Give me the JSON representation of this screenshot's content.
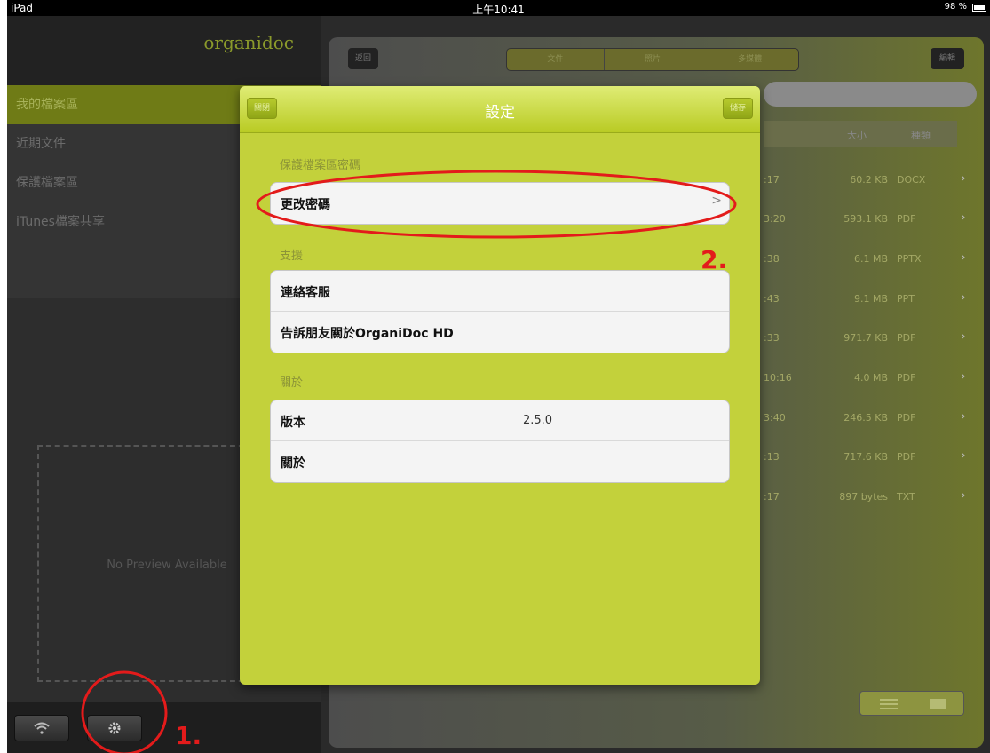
{
  "status_bar": {
    "device": "iPad",
    "time": "上午10:41",
    "battery": "98 %"
  },
  "sidebar": {
    "logo": "organidoc",
    "menu": [
      {
        "label": "我的檔案區",
        "active": true
      },
      {
        "label": "近期文件",
        "active": false
      },
      {
        "label": "保護檔案區",
        "active": false
      },
      {
        "label": "iTunes檔案共享",
        "active": false
      }
    ],
    "preview_text": "No Preview Available",
    "toolbar": {
      "wifi_icon": "wifi-icon",
      "settings_icon": "gear-icon"
    }
  },
  "content": {
    "back_label": "返回",
    "segments": [
      "文件",
      "照片",
      "多媒體"
    ],
    "edit_label": "編輯",
    "columns": {
      "size": "大小",
      "type": "種類"
    },
    "rows": [
      {
        "time": ":17",
        "size": "60.2 KB",
        "type": "DOCX"
      },
      {
        "time": "3:20",
        "size": "593.1 KB",
        "type": "PDF"
      },
      {
        "time": ":38",
        "size": "6.1 MB",
        "type": "PPTX"
      },
      {
        "time": ":43",
        "size": "9.1 MB",
        "type": "PPT"
      },
      {
        "time": ":33",
        "size": "971.7 KB",
        "type": "PDF"
      },
      {
        "time": "10:16",
        "size": "4.0 MB",
        "type": "PDF"
      },
      {
        "time": "3:40",
        "size": "246.5 KB",
        "type": "PDF"
      },
      {
        "time": ":13",
        "size": "717.6 KB",
        "type": "PDF"
      },
      {
        "time": ":17",
        "size": "897 bytes",
        "type": "TXT"
      }
    ]
  },
  "settings_modal": {
    "title": "設定",
    "left_button": "關閉",
    "right_button": "儲存",
    "sections": [
      {
        "header": "保護檔案區密碼",
        "cells": [
          {
            "label": "更改密碼",
            "value": "",
            "chevron": ">"
          }
        ]
      },
      {
        "header": "支援",
        "cells": [
          {
            "label": "連絡客服",
            "value": ""
          },
          {
            "label": "告訴朋友關於OrganiDoc HD",
            "value": ""
          }
        ]
      },
      {
        "header": "關於",
        "cells": [
          {
            "label": "版本",
            "value": "2.5.0"
          },
          {
            "label": "關於",
            "value": ""
          }
        ]
      }
    ]
  },
  "annotations": {
    "step1": "1.",
    "step2": "2.",
    "color": "#e31b1b"
  }
}
